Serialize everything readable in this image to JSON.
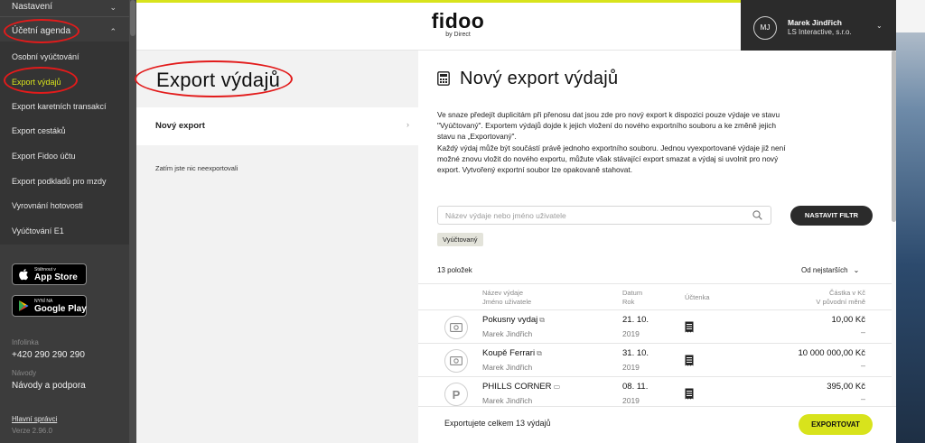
{
  "sidebar": {
    "settings_label": "Nastavení",
    "agenda_label": "Účetní agenda",
    "items": [
      {
        "label": "Osobní vyúčtování"
      },
      {
        "label": "Export výdajů"
      },
      {
        "label": "Export karetních transakcí"
      },
      {
        "label": "Export cestáků"
      },
      {
        "label": "Export Fidoo účtu"
      },
      {
        "label": "Export podkladů pro mzdy"
      },
      {
        "label": "Vyrovnání hotovosti"
      },
      {
        "label": "Vyúčtování E1"
      }
    ],
    "active_index": 1,
    "appstore": {
      "small": "Stáhnout v",
      "big": "App Store"
    },
    "googleplay": {
      "small": "NYNÍ NA",
      "big": "Google Play"
    },
    "infolinka_label": "Infolinka",
    "infolinka_value": "+420 290 290 290",
    "navody_label": "Návody",
    "navody_value": "Návody a podpora",
    "admins_link": "Hlavní správci",
    "version": "Verze 2.96.0"
  },
  "header": {
    "logo_word": "fidoo",
    "logo_by": "by Direct",
    "user_initials": "MJ",
    "user_name": "Marek Jindřich",
    "user_company": "LS Interactive, s.r.o."
  },
  "mid": {
    "title": "Export výdajů",
    "new_export_label": "Nový export",
    "empty_text": "Zatím jste nic neexportovali"
  },
  "main": {
    "title": "Nový export výdajů",
    "description_lines": [
      "Ve snaze předejít duplicitám při přenosu dat jsou zde pro nový export k dispozici pouze výdaje ve stavu",
      "\"Vyúčtovaný\". Exportem výdajů dojde k jejich vložení do nového exportního souboru a ke změně jejich",
      "stavu na „Exportovaný\".",
      "Každý výdaj může být součástí právě jednoho exportního souboru. Jednou vyexportované výdaje již není",
      "možné znovu vložit do nového exportu, můžute však stávající export smazat a výdaj si uvolnit pro nový",
      "export. Vytvořený exportní soubor lze opakovaně stahovat."
    ],
    "search_placeholder": "Název výdaje nebo jméno uživatele",
    "filter_label": "NASTAVIT FILTR",
    "chip_label": "Vyúčtovaný",
    "count_label": "13 položek",
    "sort_label": "Od nejstarších",
    "columns": {
      "name_line1": "Název výdaje",
      "name_line2": "Jméno uživatele",
      "date_line1": "Datum",
      "date_line2": "Rok",
      "receipt": "Účtenka",
      "amount_line1": "Částka v Kč",
      "amount_line2": "V původní měně"
    },
    "rows": [
      {
        "name": "Pokusny vydaj",
        "user": "Marek Jindřich",
        "date": "21. 10.",
        "year": "2019",
        "amount": "10,00 Kč",
        "orig": "–",
        "avatar": "cash-icon"
      },
      {
        "name": "Koupě Ferrari",
        "user": "Marek Jindřich",
        "date": "31. 10.",
        "year": "2019",
        "amount": "10 000 000,00 Kč",
        "orig": "–",
        "avatar": "cash-icon"
      },
      {
        "name": "PHILLS CORNER",
        "user": "Marek Jindřich",
        "date": "08. 11.",
        "year": "2019",
        "amount": "395,00 Kč",
        "orig": "–",
        "avatar": "parking-icon",
        "avatar_letter": "P"
      }
    ]
  },
  "footer": {
    "text": "Exportujete celkem 13 výdajů",
    "export_label": "EXPORTOVAT"
  },
  "colors": {
    "accent": "#d8e31c",
    "sidebar_bg": "#3c3c3c",
    "annotation": "#e21b1b"
  }
}
